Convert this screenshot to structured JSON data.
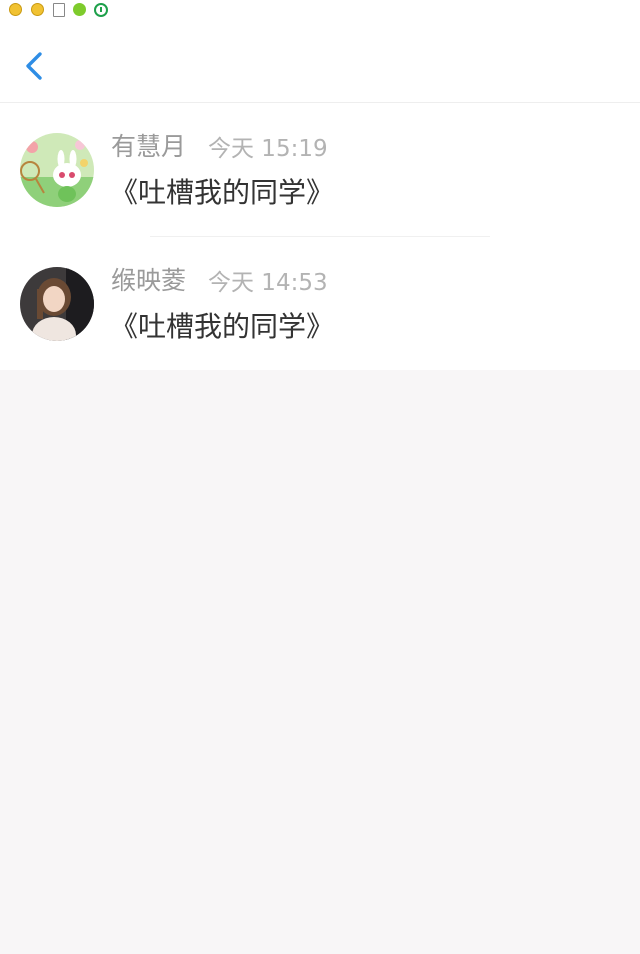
{
  "header": {
    "back_icon": "chevron-left-icon",
    "accent_color": "#2e8de5"
  },
  "messages": [
    {
      "name": "有慧月",
      "time": "今天 15:19",
      "text": "《吐槽我的同学》",
      "avatar_icon": "cartoon-bunny-avatar"
    },
    {
      "name": "缑映菱",
      "time": "今天 14:53",
      "text": "《吐槽我的同学》",
      "avatar_icon": "portrait-photo-avatar"
    }
  ]
}
